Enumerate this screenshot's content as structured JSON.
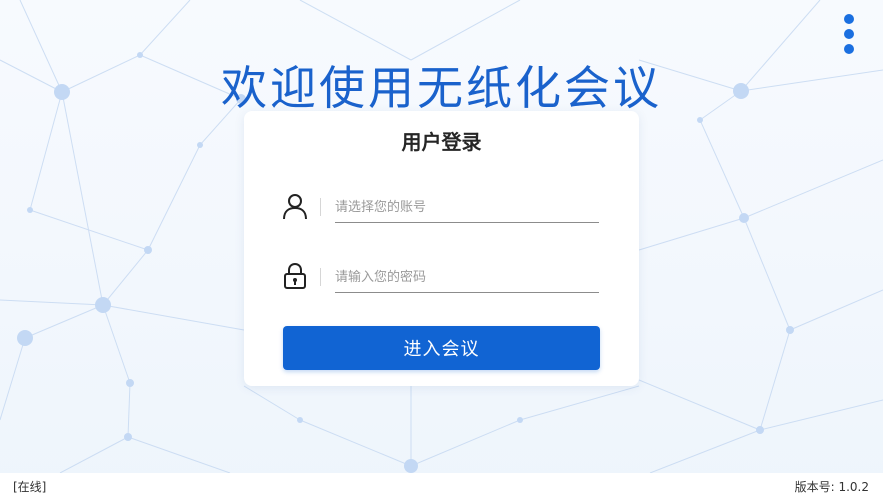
{
  "header": {
    "title": "欢迎使用无纸化会议"
  },
  "menu": {
    "icon": "more-vertical-icon"
  },
  "login": {
    "title": "用户登录",
    "account": {
      "icon": "user-icon",
      "placeholder": "请选择您的账号",
      "value": ""
    },
    "password": {
      "icon": "lock-icon",
      "placeholder": "请输入您的密码",
      "value": ""
    },
    "submit_label": "进入会议"
  },
  "footer": {
    "status": "[在线]",
    "version_label": "版本号: 1.0.2"
  },
  "colors": {
    "brand": "#1a62cc",
    "button": "#1164d3",
    "menu_dots": "#1a6fe0"
  }
}
